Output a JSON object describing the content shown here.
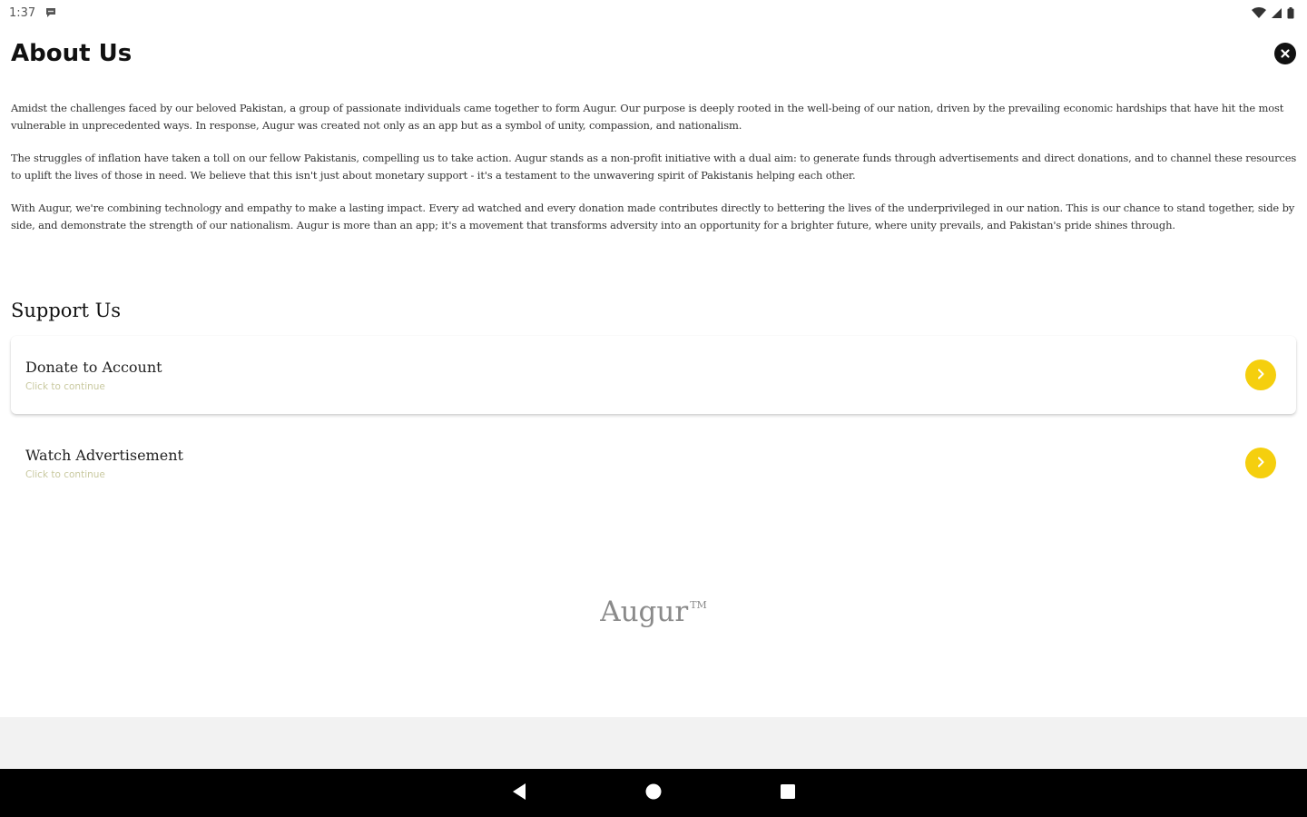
{
  "status_bar": {
    "time": "1:37",
    "icons": [
      "chat-notification-icon",
      "wifi-icon",
      "signal-icon",
      "battery-icon"
    ]
  },
  "header": {
    "title": "About Us",
    "close_icon": "close-icon"
  },
  "about": {
    "paragraphs": [
      "Amidst the challenges faced by our beloved Pakistan, a group of passionate individuals came together to form Augur. Our purpose is deeply rooted in the well-being of our nation, driven by the prevailing economic hardships that have hit the most vulnerable in unprecedented ways. In response, Augur was created not only as an app but as a symbol of unity, compassion, and nationalism.",
      "The struggles of inflation have taken a toll on our fellow Pakistanis, compelling us to take action. Augur stands as a non-profit initiative with a dual aim: to generate funds through advertisements and direct donations, and to channel these resources to uplift the lives of those in need. We believe that this isn't just about monetary support - it's a testament to the unwavering spirit of Pakistanis helping each other.",
      "With Augur, we're combining technology and empathy to make a lasting impact. Every ad watched and every donation made contributes directly to bettering the lives of the underprivileged in our nation. This is our chance to stand together, side by side, and demonstrate the strength of our nationalism. Augur is more than an app; it's a movement that transforms adversity into an opportunity for a brighter future, where unity prevails, and Pakistan's pride shines through."
    ]
  },
  "support": {
    "title": "Support Us",
    "items": [
      {
        "label": "Donate to Account",
        "sublabel": "Click to continue",
        "icon": "chevron-right-icon"
      },
      {
        "label": "Watch Advertisement",
        "sublabel": "Click to continue",
        "icon": "chevron-right-icon"
      }
    ]
  },
  "brand": {
    "name": "Augur",
    "trademark": "TM"
  },
  "colors": {
    "accent": "#f5cf0e",
    "nav_bar": "#000000",
    "bottom_strip": "#f2f2f2"
  },
  "nav_bar": {
    "buttons": [
      "back-icon",
      "home-icon",
      "recents-icon"
    ]
  }
}
